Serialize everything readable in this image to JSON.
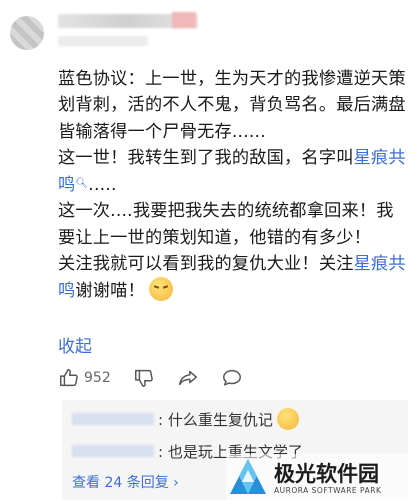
{
  "post": {
    "paragraphs": [
      {
        "text": "蓝色协议：上一世，生为天才的我惨遭逆天策划背刺，活的不人不鬼，背负骂名。最后满盘皆输落得一个尸骨无存......"
      },
      {
        "pre": "这一世！我转生到了我的敌国，名字叫",
        "link": "星痕共鸣",
        "post": "....."
      },
      {
        "text": "这一次....我要把我失去的统统都拿回来！我要让上一世的策划知道，他错的有多少！"
      },
      {
        "pre": "关注我就可以看到我的复仇大业！关注",
        "link": "星痕共鸣",
        "post": "谢谢喵！"
      }
    ],
    "link_color": "#3d6fd6"
  },
  "collapse_label": "收起",
  "actions": {
    "like_count": "952",
    "icons": [
      "thumbs-up-icon",
      "dislike-icon",
      "share-icon",
      "comment-icon"
    ]
  },
  "replies": {
    "items": [
      {
        "text": ": 什么重生复仇记"
      },
      {
        "text": ": 也是玩上重生文学了"
      }
    ],
    "more_label": "查看 24 条回复 ›"
  },
  "watermark": {
    "title": "极光软件园",
    "subtitle": "AURORA SOFTWARE PARK"
  }
}
